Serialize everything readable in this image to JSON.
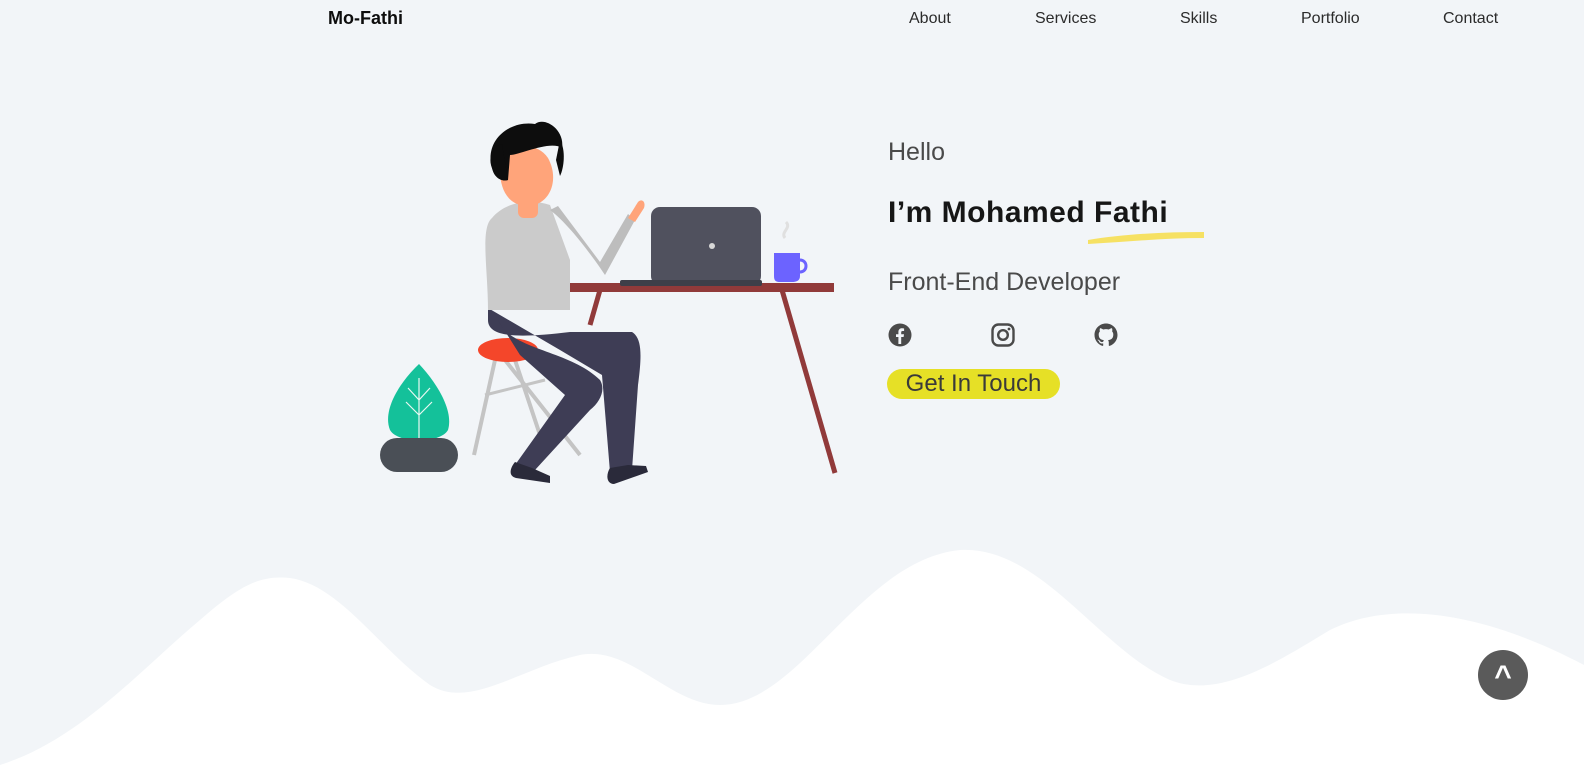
{
  "nav": {
    "logo": "Mo-Fathi",
    "links": [
      {
        "label": "About"
      },
      {
        "label": "Services"
      },
      {
        "label": "Skills"
      },
      {
        "label": "Portfolio"
      },
      {
        "label": "Contact"
      }
    ]
  },
  "hero": {
    "greeting": "Hello",
    "name": "I’m Mohamed Fathi",
    "role": "Front-End Developer",
    "cta_label": "Get In Touch",
    "social": [
      {
        "icon": "facebook-icon"
      },
      {
        "icon": "instagram-icon"
      },
      {
        "icon": "github-icon"
      }
    ]
  },
  "scroll_top": {
    "label": "^"
  },
  "colors": {
    "background": "#f2f5f8",
    "accent_yellow": "#e6e026",
    "underline_yellow": "#f6df52",
    "text_dark": "#161616",
    "text_gray": "#4a4a4a",
    "scroll_button": "#5a5a5a"
  }
}
